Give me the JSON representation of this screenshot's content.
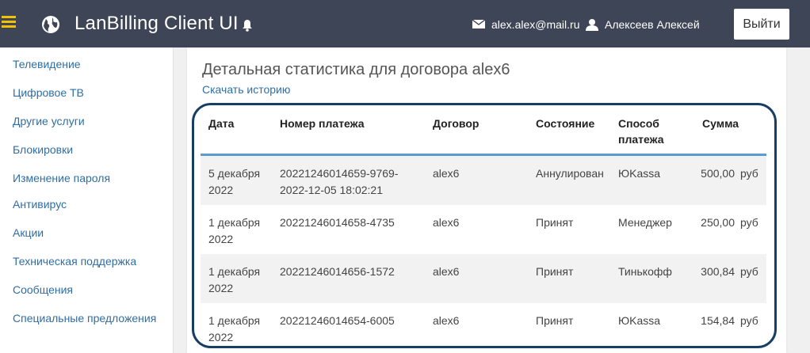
{
  "navbar": {
    "menu_icon": "hamburger-icon",
    "brand_icon": "globe-icon",
    "brand": "LanBilling Client UI",
    "notify_icon": "bell-icon",
    "mail_icon": "envelope-icon",
    "email": "alex.alex@mail.ru",
    "user_icon": "user-icon",
    "username": "Алексеев Алексей",
    "logout_label": "Выйти"
  },
  "sidebar": {
    "items": [
      {
        "label": "Телевидение"
      },
      {
        "label": "Цифровое ТВ"
      },
      {
        "label": "Другие услуги"
      },
      {
        "label": "Блокировки"
      },
      {
        "label": "Изменение пароля"
      },
      {
        "label": "Антивирус"
      },
      {
        "label": "Акции"
      },
      {
        "label": "Техническая поддержка"
      },
      {
        "label": "Сообщения"
      },
      {
        "label": "Специальные предложения"
      }
    ]
  },
  "main": {
    "title": "Детальная статистика для договора alex6",
    "download_link": "Скачать историю",
    "table": {
      "headers": {
        "date": "Дата",
        "payment_number": "Номер платежа",
        "contract": "Договор",
        "status": "Состояние",
        "method_line1": "Способ",
        "method_line2": "платежа",
        "amount": "Сумма"
      },
      "rows": [
        {
          "date_line1": "5 декабря",
          "date_line2": "2022",
          "number_line1": "20221246014659-9769-",
          "number_line2": "2022-12-05 18:02:21",
          "contract": "alex6",
          "status": "Аннулирован",
          "method": "ЮKassa",
          "amount": "500,00",
          "currency": "руб"
        },
        {
          "date_line1": "1 декабря",
          "date_line2": "2022",
          "number_line1": "20221246014658-4735",
          "number_line2": "",
          "contract": "alex6",
          "status": "Принят",
          "method": "Менеджер",
          "amount": "250,00",
          "currency": "руб"
        },
        {
          "date_line1": "1 декабря",
          "date_line2": "2022",
          "number_line1": "20221246014656-1572",
          "number_line2": "",
          "contract": "alex6",
          "status": "Принят",
          "method": "Тинькофф",
          "amount": "300,84",
          "currency": "руб"
        },
        {
          "date_line1": "1 декабря",
          "date_line2": "2022",
          "number_line1": "20221246014654-6005",
          "number_line2": "",
          "contract": "alex6",
          "status": "Принят",
          "method": "ЮKassa",
          "amount": "154,84",
          "currency": "руб"
        }
      ]
    }
  },
  "colors": {
    "navbar_bg": "#3e4556",
    "menu_accent": "#f2c200",
    "link": "#2f6ea5",
    "table_header_rule": "#5b9bd1",
    "highlight_frame": "#173e63"
  }
}
